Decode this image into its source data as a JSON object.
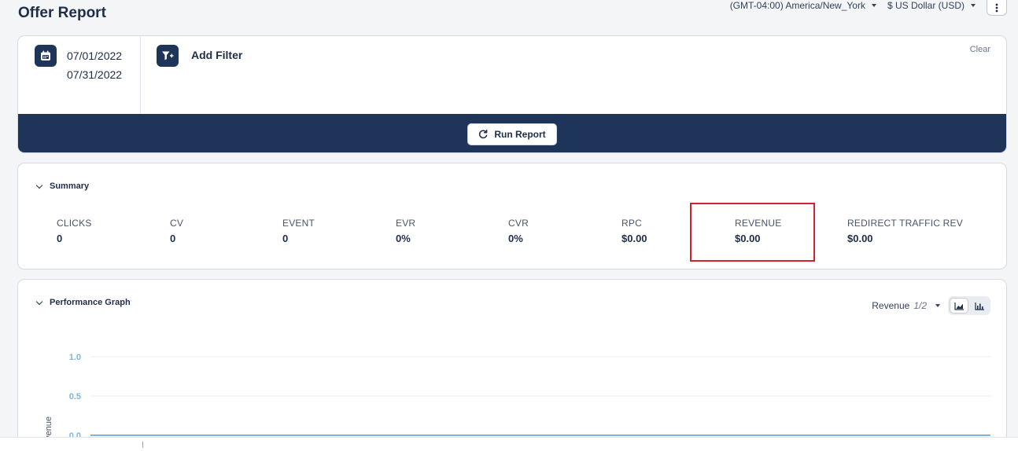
{
  "header": {
    "title": "Offer Report",
    "timezone": "(GMT-04:00) America/New_York",
    "currency": "$ US Dollar (USD)",
    "more_icon": "kebab-vertical-icon"
  },
  "filters": {
    "date_start": "07/01/2022",
    "date_end": "07/31/2022",
    "add_filter_label": "Add Filter",
    "clear_label": "Clear",
    "run_report_label": "Run Report"
  },
  "summary": {
    "title": "Summary",
    "metrics": [
      {
        "label": "CLICKS",
        "value": "0"
      },
      {
        "label": "CV",
        "value": "0"
      },
      {
        "label": "EVENT",
        "value": "0"
      },
      {
        "label": "EVR",
        "value": "0%"
      },
      {
        "label": "CVR",
        "value": "0%"
      },
      {
        "label": "RPC",
        "value": "$0.00"
      },
      {
        "label": "REVENUE",
        "value": "$0.00"
      },
      {
        "label": "REDIRECT TRAFFIC REV",
        "value": "$0.00"
      }
    ]
  },
  "graph": {
    "title": "Performance Graph",
    "metric_selector": "Revenue",
    "pager": "1/2"
  },
  "chart_data": {
    "type": "line",
    "ylabel": "Revenue",
    "y_ticks": [
      "1.0",
      "0.5",
      "0.0"
    ],
    "ylim": [
      0,
      1
    ],
    "series": [
      {
        "values": [
          0,
          0
        ]
      }
    ],
    "grid": true
  },
  "colors": {
    "primary": "#1f3459",
    "highlight": "#d5202e",
    "series_line": "#7fb2e5"
  }
}
